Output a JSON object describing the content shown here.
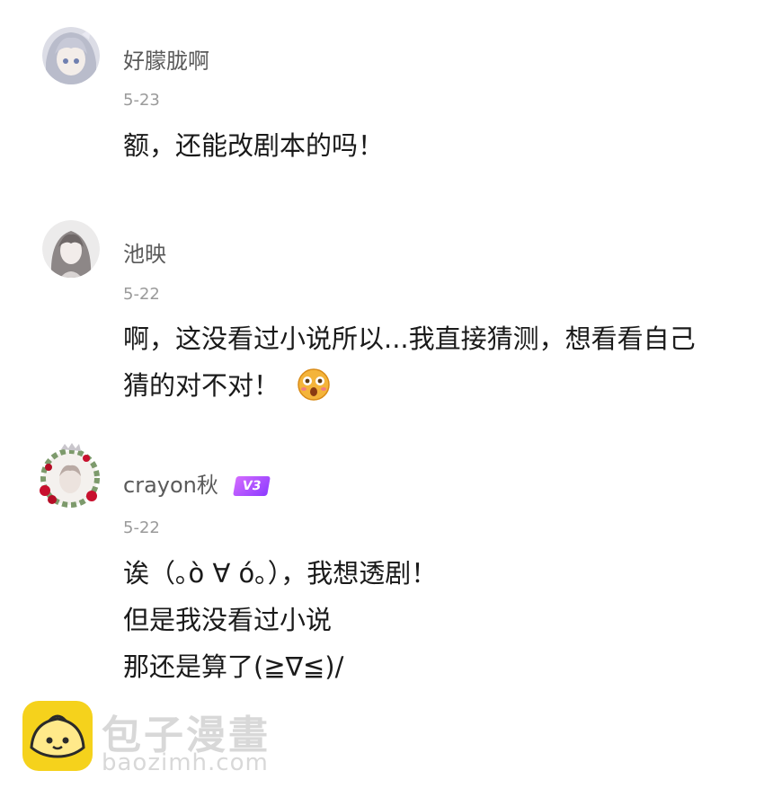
{
  "comments": [
    {
      "username": "好朦胧啊",
      "date": "5-23",
      "lines": [
        "额，还能改剧本的吗！"
      ]
    },
    {
      "username": "池映",
      "date": "5-22",
      "lines": [
        "啊，这没看过小说所以...我直接猜测，想看看自己",
        "猜的对不对！"
      ],
      "emoji": "shocked-face-emoji"
    },
    {
      "username": "crayon秋",
      "badge": "V3",
      "date": "5-22",
      "lines": [
        "诶（｡ò ∀ ó｡），我想透剧！",
        "但是我没看过小说",
        "那还是算了(≧∇≦)/"
      ]
    }
  ],
  "watermark": {
    "title": "包子漫畫",
    "url": "baozimh.com",
    "logo_color": "#f5d21c"
  }
}
